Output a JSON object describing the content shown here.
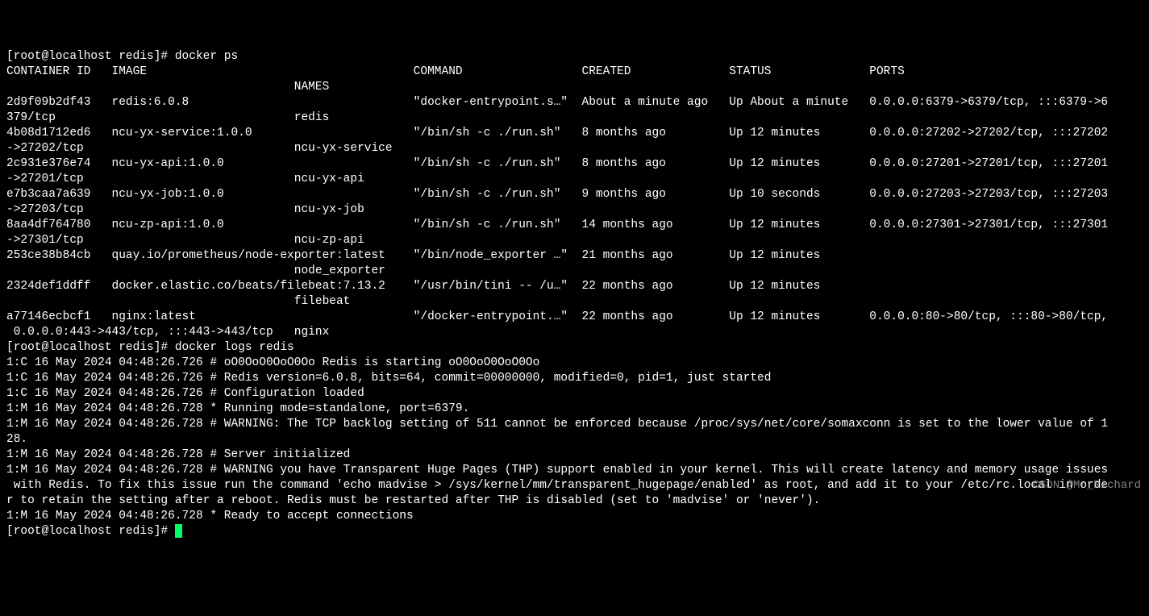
{
  "prompt1": {
    "prefix": "[root@localhost redis]# ",
    "cmd": "docker ps"
  },
  "headers": {
    "cid": "CONTAINER ID",
    "image": "IMAGE",
    "command": "COMMAND",
    "created": "CREATED",
    "status": "STATUS",
    "ports": "PORTS",
    "names": "NAMES"
  },
  "rows": [
    {
      "cid": "2d9f09b2df43",
      "image": "redis:6.0.8",
      "command": "\"docker-entrypoint.s…\"",
      "created": "About a minute ago",
      "status": "Up About a minute",
      "ports": "0.0.0.0:6379->6379/tcp, :::6379->6379/tcp",
      "names": "redis"
    },
    {
      "cid": "4b08d1712ed6",
      "image": "ncu-yx-service:1.0.0",
      "command": "\"/bin/sh -c ./run.sh\"",
      "created": "8 months ago",
      "status": "Up 12 minutes",
      "ports": "0.0.0.0:27202->27202/tcp, :::27202->27202/tcp",
      "names": "ncu-yx-service"
    },
    {
      "cid": "2c931e376e74",
      "image": "ncu-yx-api:1.0.0",
      "command": "\"/bin/sh -c ./run.sh\"",
      "created": "8 months ago",
      "status": "Up 12 minutes",
      "ports": "0.0.0.0:27201->27201/tcp, :::27201->27201/tcp",
      "names": "ncu-yx-api"
    },
    {
      "cid": "e7b3caa7a639",
      "image": "ncu-yx-job:1.0.0",
      "command": "\"/bin/sh -c ./run.sh\"",
      "created": "9 months ago",
      "status": "Up 10 seconds",
      "ports": "0.0.0.0:27203->27203/tcp, :::27203->27203/tcp",
      "names": "ncu-yx-job"
    },
    {
      "cid": "8aa4df764780",
      "image": "ncu-zp-api:1.0.0",
      "command": "\"/bin/sh -c ./run.sh\"",
      "created": "14 months ago",
      "status": "Up 12 minutes",
      "ports": "0.0.0.0:27301->27301/tcp, :::27301->27301/tcp",
      "names": "ncu-zp-api"
    },
    {
      "cid": "253ce38b84cb",
      "image": "quay.io/prometheus/node-exporter:latest",
      "command": "\"/bin/node_exporter …\"",
      "created": "21 months ago",
      "status": "Up 12 minutes",
      "ports": "",
      "names": "node_exporter"
    },
    {
      "cid": "2324def1ddff",
      "image": "docker.elastic.co/beats/filebeat:7.13.2",
      "command": "\"/usr/bin/tini -- /u…\"",
      "created": "22 months ago",
      "status": "Up 12 minutes",
      "ports": "",
      "names": "filebeat"
    },
    {
      "cid": "a77146ecbcf1",
      "image": "nginx:latest",
      "command": "\"/docker-entrypoint.…\"",
      "created": "22 months ago",
      "status": "Up 12 minutes",
      "ports": "0.0.0.0:80->80/tcp, :::80->80/tcp, 0.0.0.0:443->443/tcp, :::443->443/tcp",
      "names": "nginx"
    }
  ],
  "prompt2": {
    "prefix": "[root@localhost redis]# ",
    "cmd": "docker logs redis"
  },
  "logs": [
    "1:C 16 May 2024 04:48:26.726 # oO0OoO0OoO0Oo Redis is starting oO0OoO0OoO0Oo",
    "1:C 16 May 2024 04:48:26.726 # Redis version=6.0.8, bits=64, commit=00000000, modified=0, pid=1, just started",
    "1:C 16 May 2024 04:48:26.726 # Configuration loaded",
    "1:M 16 May 2024 04:48:26.728 * Running mode=standalone, port=6379.",
    "1:M 16 May 2024 04:48:26.728 # WARNING: The TCP backlog setting of 511 cannot be enforced because /proc/sys/net/core/somaxconn is set to the lower value of 128.",
    "1:M 16 May 2024 04:48:26.728 # Server initialized",
    "1:M 16 May 2024 04:48:26.728 # WARNING you have Transparent Huge Pages (THP) support enabled in your kernel. This will create latency and memory usage issues with Redis. To fix this issue run the command 'echo madvise > /sys/kernel/mm/transparent_hugepage/enabled' as root, and add it to your /etc/rc.local in order to retain the setting after a reboot. Redis must be restarted after THP is disabled (set to 'madvise' or 'never').",
    "1:M 16 May 2024 04:48:26.728 * Ready to accept connections"
  ],
  "prompt3": {
    "prefix": "[root@localhost redis]# "
  },
  "watermark": "CSDN @Mr_Richard",
  "cols": {
    "cid": 0,
    "image": 15,
    "command": 58,
    "created": 82,
    "status": 103,
    "ports": 123,
    "names": 41,
    "total": 157
  }
}
